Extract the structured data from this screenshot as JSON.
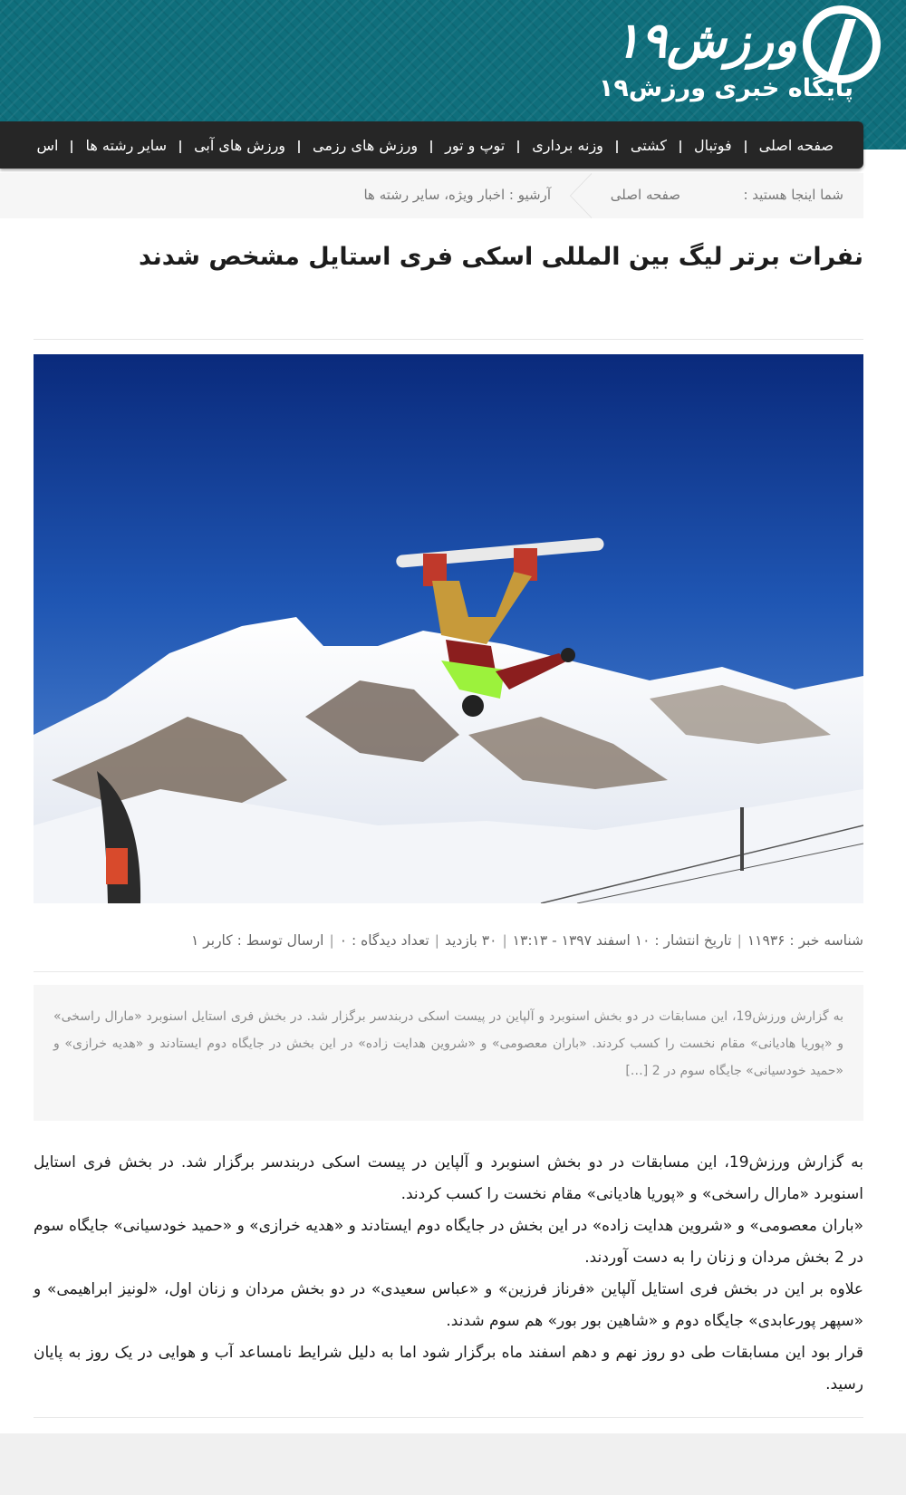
{
  "logo": {
    "wordmark": "ورزش۱۹",
    "subtitle": "پایگاه خبری ورزش۱۹"
  },
  "nav": {
    "items": [
      "صفحه اصلی",
      "فوتبال",
      "کشتی",
      "وزنه برداری",
      "توپ و تور",
      "ورزش های رزمی",
      "ورزش های آبی",
      "سایر رشته ها",
      "اس"
    ]
  },
  "breadcrumb": {
    "label": "شما اینجا هستید :",
    "home": "صفحه اصلی",
    "current": "آرشیو : اخبار ویژه، سایر رشته ها"
  },
  "article": {
    "title": "نفرات برتر لیگ بین المللی اسکی فری استایل مشخص شدند",
    "photo_icon": "snowboarder-photo",
    "meta": {
      "id": "شناسه خبر : ۱۱۹۳۶",
      "date": "تاریخ انتشار : ۱۰ اسفند ۱۳۹۷ - ۱۳:۱۳",
      "views": "۳۰ بازدید",
      "comments": "تعداد دیدگاه : ۰",
      "author": "ارسال توسط : کاربر ۱"
    },
    "excerpt": "به گزارش ورزش19، این مسابقات در دو بخش اسنوبرد و آلپاین در پیست اسکی دربندسر برگزار شد. در بخش فری استایل اسنوبرد «مارال راسخی» و «پوریا هادیانی» مقام نخست را کسب کردند. «باران معصومی» و «شروین هدایت زاده» در این بخش در جایگاه دوم ایستادند و «هدیه خرازی» و «حمید خودسیانی» جایگاه سوم در 2 […]",
    "paragraphs": [
      "به گزارش ورزش19، این مسابقات در دو بخش اسنوبرد و آلپاین در پیست اسکی دربندسر برگزار شد. در بخش فری استایل اسنوبرد «مارال راسخی» و «پوریا هادیانی» مقام نخست را کسب کردند.",
      "«باران معصومی» و «شروین هدایت زاده» در این بخش در جایگاه دوم ایستادند و «هدیه خرازی» و «حمید خودسیانی» جایگاه سوم در 2 بخش مردان و زنان را به دست آوردند.",
      "علاوه بر این در بخش فری استایل آلپاین «فرناز فرزین» و «عباس سعیدی» در دو بخش مردان و زنان اول، «لونیز ابراهیمی» و «سپهر پورعابدی» جایگاه دوم و «شاهین بور بور» هم سوم شدند.",
      "قرار بود این مسابقات طی دو روز نهم و دهم اسفند ماه برگزار شود اما به دلیل شرایط نامساعد آب و هوایی در یک روز به پایان رسید."
    ]
  },
  "colors": {
    "header_teal": "#0f6f7c",
    "navbar": "#262626",
    "breadcrumb_bg": "#f6f6f6",
    "excerpt_bg": "#f6f6f6"
  }
}
